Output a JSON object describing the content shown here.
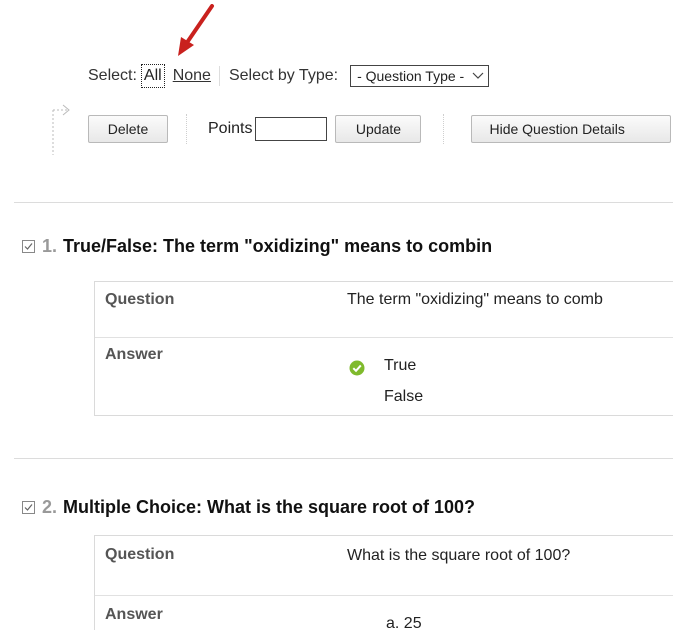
{
  "toolbar": {
    "select_label": "Select:",
    "all_label": "All",
    "none_label": "None",
    "select_by_type_label": "Select by Type:",
    "question_type_value": "- Question Type -",
    "delete_label": "Delete",
    "points_label": "Points",
    "points_value": "",
    "update_label": "Update",
    "hide_details_label": "Hide Question Details"
  },
  "questions": [
    {
      "number": "1.",
      "title": "True/False: The term \"oxidizing\" means to combin",
      "question_label": "Question",
      "question_text": "The term \"oxidizing\" means to comb",
      "answer_label": "Answer",
      "answers": [
        "True",
        "False"
      ],
      "correct_index": 0
    },
    {
      "number": "2.",
      "title": "Multiple Choice: What is the square root of 100?",
      "question_label": "Question",
      "question_text": "What is the square root of 100?",
      "answer_label": "Answer",
      "answers": [
        "a. 25"
      ]
    }
  ],
  "colors": {
    "annotation_arrow": "#c9211e",
    "correct_check": "#7fba2c",
    "question_number": "#999999"
  }
}
